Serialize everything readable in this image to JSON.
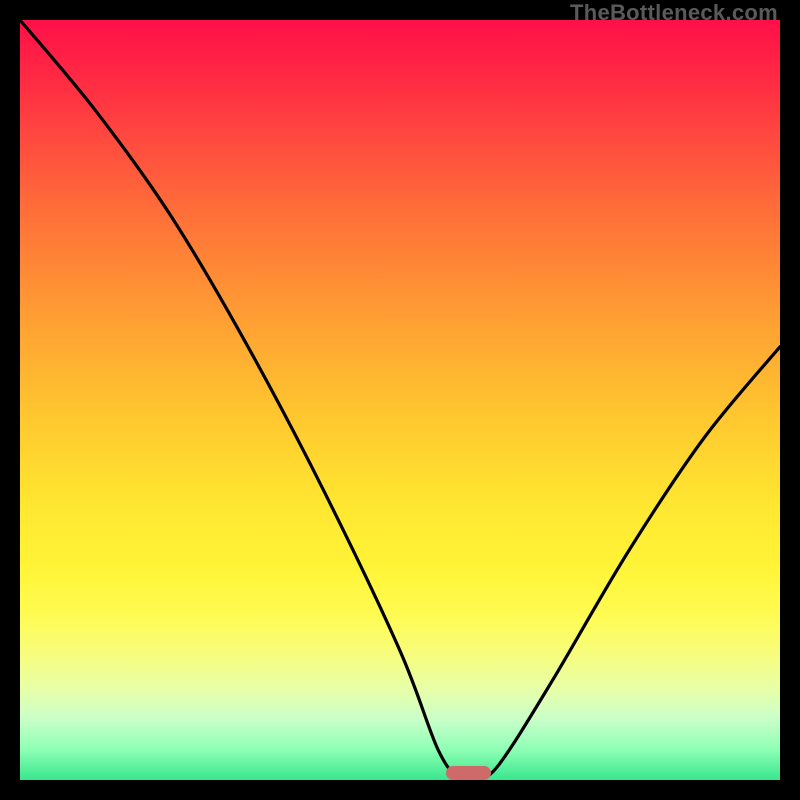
{
  "watermark": "TheBottleneck.com",
  "chart_data": {
    "type": "line",
    "title": "",
    "xlabel": "",
    "ylabel": "",
    "xlim": [
      0,
      100
    ],
    "ylim": [
      0,
      100
    ],
    "grid": false,
    "series": [
      {
        "name": "bottleneck-curve",
        "x": [
          0,
          10,
          20,
          30,
          40,
          50,
          55,
          58,
          60,
          63,
          70,
          80,
          90,
          100
        ],
        "values": [
          100,
          88,
          74,
          57,
          38,
          17,
          4,
          0,
          0,
          2,
          13,
          30,
          45,
          57
        ]
      }
    ],
    "marker": {
      "x": 59,
      "y": 0,
      "width_pct": 6
    },
    "background_gradient": {
      "top": "#ff1048",
      "mid": "#ffd22f",
      "bottom": "#38e68e"
    },
    "colors": {
      "curve": "#000000",
      "marker": "#cf6a6a",
      "frame": "#000000"
    }
  }
}
